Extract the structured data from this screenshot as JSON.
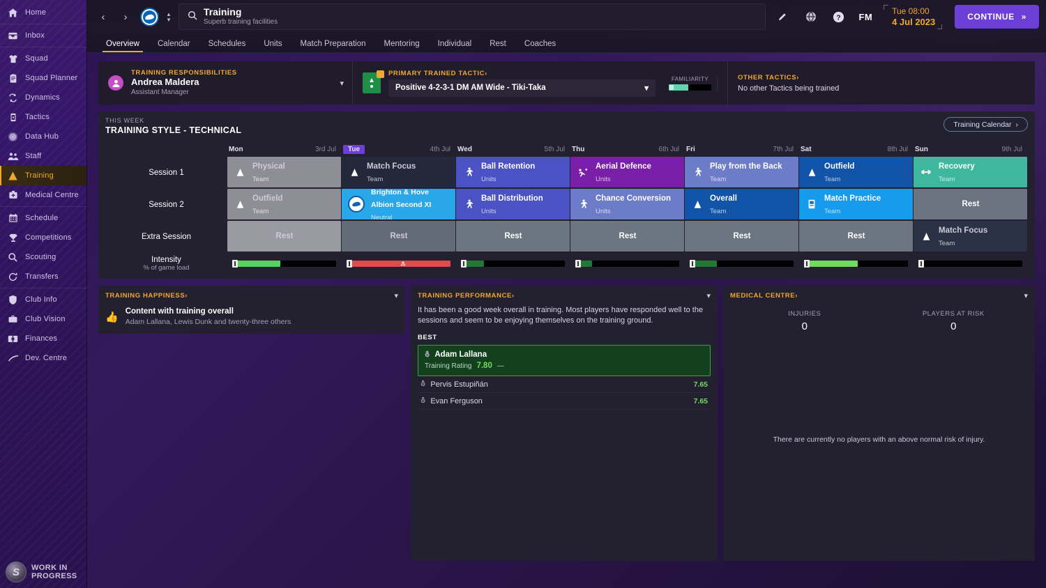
{
  "sidebar": {
    "items": [
      {
        "label": "Home",
        "icon": "home-icon",
        "sep_after": true
      },
      {
        "label": "Inbox",
        "icon": "inbox-icon",
        "sep_after": true
      },
      {
        "label": "Squad",
        "icon": "shirt-icon"
      },
      {
        "label": "Squad Planner",
        "icon": "clipboard-icon"
      },
      {
        "label": "Dynamics",
        "icon": "dynamics-icon"
      },
      {
        "label": "Tactics",
        "icon": "tactics-icon"
      },
      {
        "label": "Data Hub",
        "icon": "data-hub-icon"
      },
      {
        "label": "Staff",
        "icon": "staff-icon"
      },
      {
        "label": "Training",
        "icon": "training-icon",
        "active": true
      },
      {
        "label": "Medical Centre",
        "icon": "medical-icon",
        "sep_after": true
      },
      {
        "label": "Schedule",
        "icon": "calendar-icon"
      },
      {
        "label": "Competitions",
        "icon": "trophy-icon"
      },
      {
        "label": "Scouting",
        "icon": "magnifier-icon"
      },
      {
        "label": "Transfers",
        "icon": "transfers-icon",
        "sep_after": true
      },
      {
        "label": "Club Info",
        "icon": "shield-icon"
      },
      {
        "label": "Club Vision",
        "icon": "briefcase-icon"
      },
      {
        "label": "Finances",
        "icon": "finances-icon"
      },
      {
        "label": "Dev. Centre",
        "icon": "dev-centre-icon"
      }
    ],
    "footer": {
      "line1": "WORK IN",
      "line2": "PROGRESS"
    }
  },
  "header": {
    "back_icon": "chevron-left-icon",
    "forward_icon": "chevron-right-icon",
    "club_crest_icon": "brighton-crest-icon",
    "search_icon": "search-icon",
    "title": "Training",
    "subtitle": "Superb training facilities",
    "icons": [
      {
        "name": "edit-pencil-icon",
        "glyph": "✎"
      },
      {
        "name": "globe-icon",
        "glyph": "ἱ0"
      },
      {
        "name": "help-icon",
        "glyph": "?"
      }
    ],
    "fm_label": "FM",
    "time": "Tue 08:00",
    "date": "4 Jul 2023",
    "continue_label": "CONTINUE",
    "continue_icon": "double-chevron-right-icon",
    "accent": "#6c3fd8"
  },
  "tabs": [
    {
      "label": "Overview",
      "active": true
    },
    {
      "label": "Calendar"
    },
    {
      "label": "Schedules"
    },
    {
      "label": "Units"
    },
    {
      "label": "Match Preparation"
    },
    {
      "label": "Mentoring"
    },
    {
      "label": "Individual"
    },
    {
      "label": "Rest"
    },
    {
      "label": "Coaches"
    }
  ],
  "responsibilities": {
    "label": "TRAINING RESPONSIBILITIES",
    "name": "Andrea Maldera",
    "role": "Assistant Manager",
    "avatar_icon": "person-avatar-icon",
    "chevron_icon": "chevron-down-icon"
  },
  "primary_tactic": {
    "label": "PRIMARY TRAINED TACTIC",
    "label_arrow": "›",
    "value": "Positive 4-2-3-1 DM AM Wide - Tiki-Taka",
    "icon": "tactic-board-icon",
    "familiarity_label": "FAMILIARITY",
    "familiarity_pct": 46,
    "familiarity_color": "#5fd4b0"
  },
  "other_tactics": {
    "label": "OTHER TACTICS",
    "label_arrow": "›",
    "text": "No other Tactics being trained"
  },
  "training": {
    "this_week_label": "THIS WEEK",
    "style_label": "TRAINING STYLE - TECHNICAL",
    "calendar_button": "Training Calendar",
    "calendar_button_icon": "chevron-right-icon",
    "days": [
      {
        "name": "Mon",
        "date": "3rd Jul",
        "today": false
      },
      {
        "name": "Tue",
        "date": "4th Jul",
        "today": true
      },
      {
        "name": "Wed",
        "date": "5th Jul",
        "today": false
      },
      {
        "name": "Thu",
        "date": "6th Jul",
        "today": false
      },
      {
        "name": "Fri",
        "date": "7th Jul",
        "today": false
      },
      {
        "name": "Sat",
        "date": "8th Jul",
        "today": false
      },
      {
        "name": "Sun",
        "date": "9th Jul",
        "today": false
      }
    ],
    "rows": [
      {
        "label": "Session 1",
        "cells": [
          {
            "title": "Physical",
            "sub": "Team",
            "icon": "cone-icon",
            "bg": "#8e8e96",
            "dim": true
          },
          {
            "title": "Match Focus",
            "sub": "Team",
            "icon": "cone-icon",
            "bg": "#23283a",
            "dim": true
          },
          {
            "title": "Ball Retention",
            "sub": "Units",
            "icon": "player-icon",
            "bg": "#4a52c4"
          },
          {
            "title": "Aerial Defence",
            "sub": "Units",
            "icon": "header-icon",
            "bg": "#7a1fa8"
          },
          {
            "title": "Play from the Back",
            "sub": "Team",
            "icon": "player-icon",
            "bg": "#6d7cc9"
          },
          {
            "title": "Outfield",
            "sub": "Team",
            "icon": "cone-icon",
            "bg": "#1254a8"
          },
          {
            "title": "Recovery",
            "sub": "Team",
            "icon": "recovery-icon",
            "bg": "#3fb79e"
          }
        ]
      },
      {
        "label": "Session 2",
        "cells": [
          {
            "title": "Outfield",
            "sub": "Team",
            "icon": "cone-icon",
            "bg": "#8e8e96",
            "dim": true
          },
          {
            "title": "Brighton & Hove Albion Second XI",
            "sub": "Neutral",
            "icon": "club-crest-icon",
            "bg": "#2aa7e8",
            "match": true
          },
          {
            "title": "Ball Distribution",
            "sub": "Units",
            "icon": "player-icon",
            "bg": "#4a52c4"
          },
          {
            "title": "Chance Conversion",
            "sub": "Units",
            "icon": "player-icon",
            "bg": "#6d7cc9"
          },
          {
            "title": "Overall",
            "sub": "Team",
            "icon": "cone-icon",
            "bg": "#1254a8"
          },
          {
            "title": "Match Practice",
            "sub": "Team",
            "icon": "board-icon",
            "bg": "#179ced"
          },
          {
            "title": "Rest",
            "sub": "",
            "icon": "",
            "bg": "#6c7380",
            "center": true
          }
        ]
      },
      {
        "label": "Extra Session",
        "cells": [
          {
            "title": "Rest",
            "sub": "",
            "icon": "",
            "bg": "#9a9aa2",
            "center": true,
            "dim": true
          },
          {
            "title": "Rest",
            "sub": "",
            "icon": "",
            "bg": "#636b78",
            "center": true,
            "dim": true
          },
          {
            "title": "Rest",
            "sub": "",
            "icon": "",
            "bg": "#6c7682",
            "center": true
          },
          {
            "title": "Rest",
            "sub": "",
            "icon": "",
            "bg": "#6c7682",
            "center": true
          },
          {
            "title": "Rest",
            "sub": "",
            "icon": "",
            "bg": "#6c7682",
            "center": true
          },
          {
            "title": "Rest",
            "sub": "",
            "icon": "",
            "bg": "#6c7682",
            "center": true
          },
          {
            "title": "Match Focus",
            "sub": "Team",
            "icon": "cone-icon",
            "bg": "#2b3146",
            "dim": true
          }
        ]
      }
    ],
    "intensity": {
      "label": "Intensity",
      "sublabel": "% of game load",
      "bars": [
        {
          "pct": 46,
          "color": "#56d45c",
          "warn": false
        },
        {
          "pct": 100,
          "color": "#e04b4b",
          "warn": true,
          "warn_glyph": "⚠"
        },
        {
          "pct": 22,
          "color": "#1f7a35",
          "warn": false
        },
        {
          "pct": 16,
          "color": "#1f7a35",
          "warn": false
        },
        {
          "pct": 26,
          "color": "#1f7a35",
          "warn": false
        },
        {
          "pct": 52,
          "color": "#6fdc5e",
          "warn": false
        },
        {
          "pct": 4,
          "color": "#1c3f8a",
          "warn": false
        }
      ]
    }
  },
  "happiness": {
    "label": "TRAINING HAPPINESS",
    "label_arrow": "›",
    "chevron_icon": "chevron-down-icon",
    "thumb_icon": "thumbs-up-icon",
    "headline": "Content with training overall",
    "detail": "Adam Lallana, Lewis Dunk and twenty-three others"
  },
  "performance": {
    "label": "TRAINING PERFORMANCE",
    "label_arrow": "›",
    "chevron_icon": "chevron-down-icon",
    "summary": "It has been a good week overall in training. Most players have responded well to the sessions and seem to be enjoying themselves on the training ground.",
    "best_label": "BEST",
    "best": {
      "name": "Adam Lallana",
      "rating_label": "Training Rating",
      "rating": "7.80",
      "trend": "—",
      "shirt_icon": "shirt-icon"
    },
    "others": [
      {
        "name": "Pervis Estupiñán",
        "rating": "7.65",
        "shirt_icon": "shirt-icon"
      },
      {
        "name": "Evan Ferguson",
        "rating": "7.65",
        "shirt_icon": "shirt-icon"
      }
    ]
  },
  "medical": {
    "label": "MEDICAL CENTRE",
    "label_arrow": "›",
    "chevron_icon": "chevron-down-icon",
    "stats": [
      {
        "label": "INJURIES",
        "value": "0"
      },
      {
        "label": "PLAYERS AT RISK",
        "value": "0"
      }
    ],
    "note": "There are currently no players with an above normal risk of injury."
  }
}
